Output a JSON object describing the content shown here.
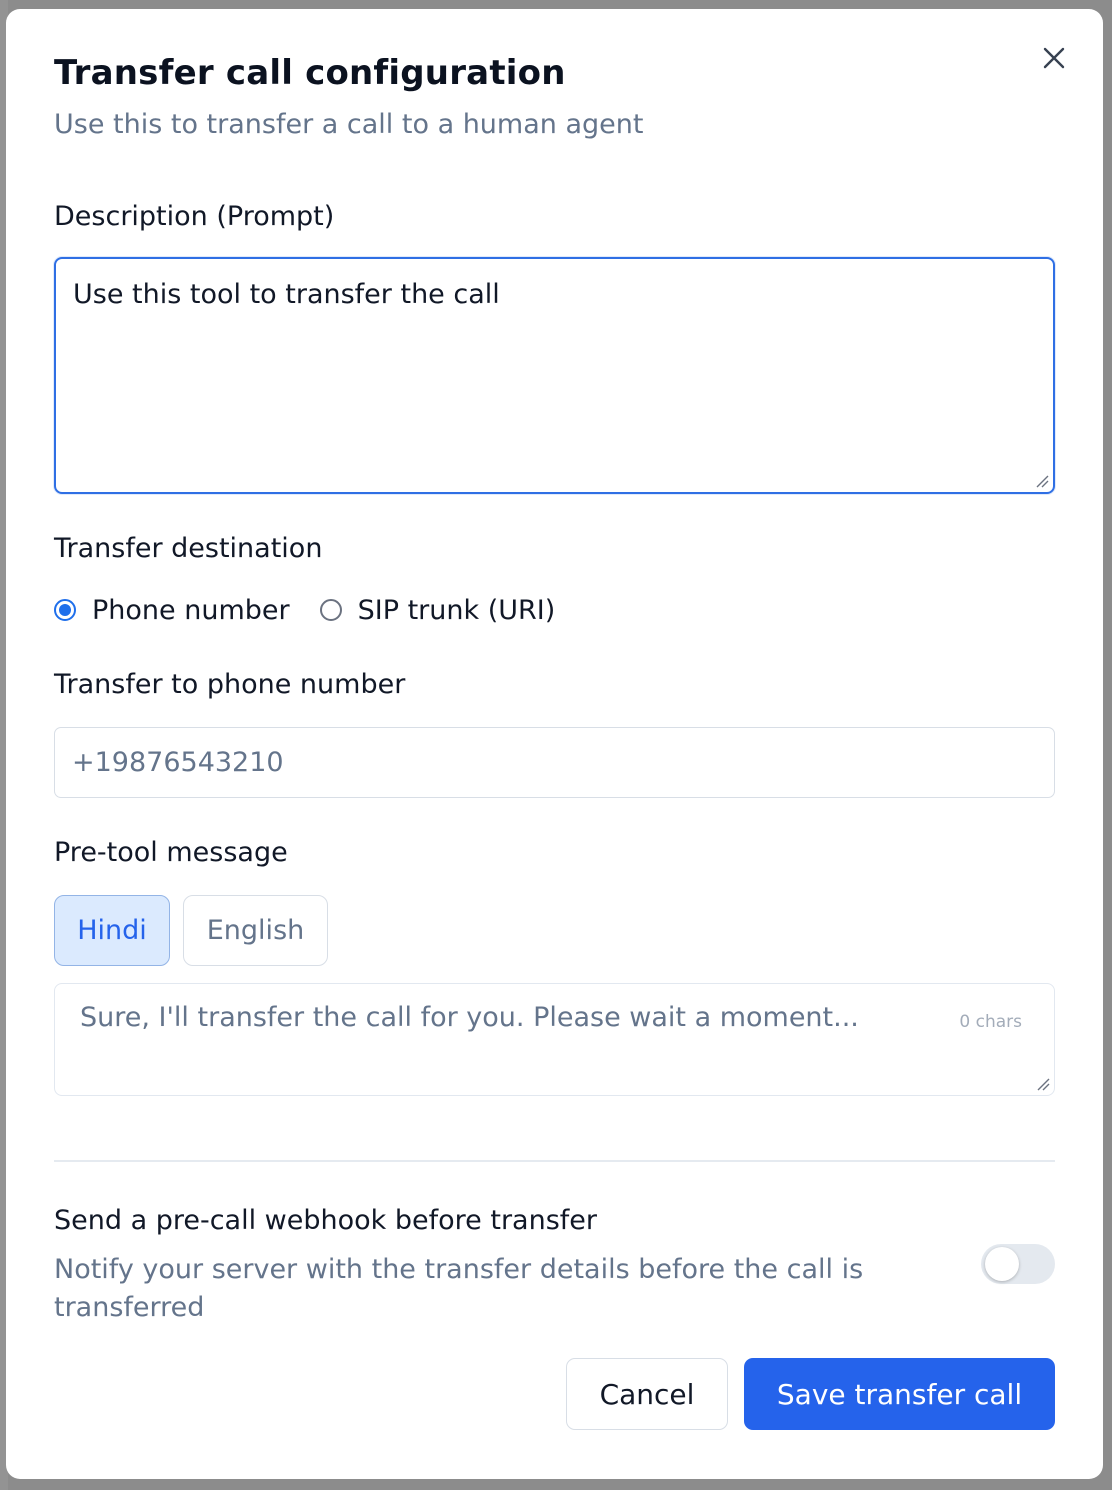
{
  "dialog": {
    "title": "Transfer call configuration",
    "subtitle": "Use this to transfer a call to a human agent",
    "close_icon": "close-icon"
  },
  "description": {
    "label": "Description (Prompt)",
    "value": "Use this tool to transfer the call"
  },
  "destination": {
    "label": "Transfer destination",
    "options": [
      {
        "label": "Phone number",
        "checked": true
      },
      {
        "label": "SIP trunk (URI)",
        "checked": false
      }
    ]
  },
  "phone": {
    "label": "Transfer to phone number",
    "placeholder": "+19876543210"
  },
  "pre_tool": {
    "label": "Pre-tool message",
    "languages": [
      "Hindi",
      "English"
    ],
    "selected_language": "Hindi",
    "placeholder": "Sure, I'll transfer the call for you. Please wait a moment...",
    "char_count": "0 chars"
  },
  "webhook": {
    "title": "Send a pre-call webhook before transfer",
    "description": "Notify your server with the transfer details before the call is transferred",
    "enabled": false
  },
  "actions": {
    "cancel_label": "Cancel",
    "save_label": "Save transfer call"
  },
  "colors": {
    "accent": "#2563eb",
    "muted_text": "#64748b"
  }
}
